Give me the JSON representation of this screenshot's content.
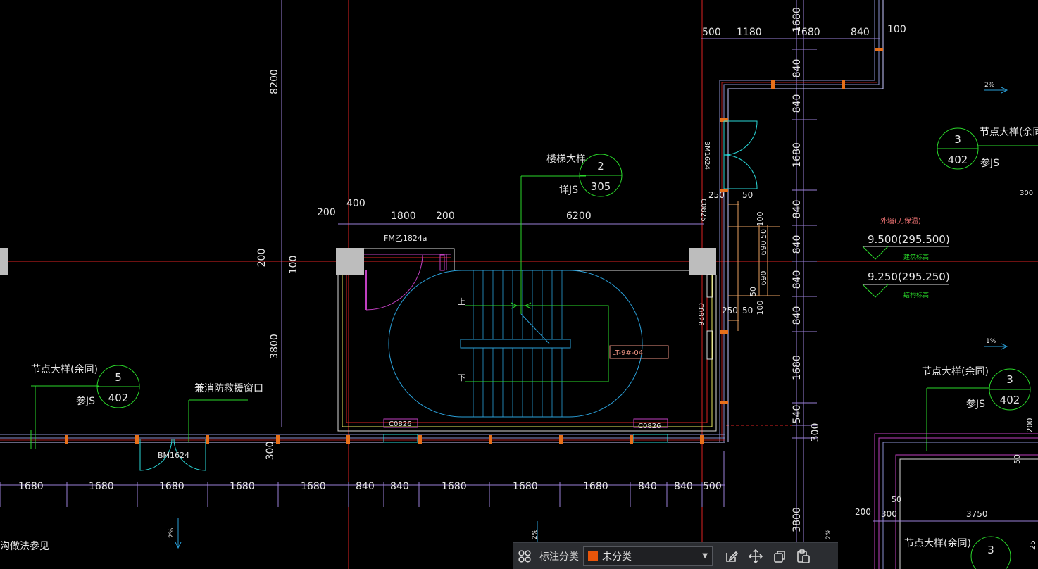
{
  "texts": {
    "top_dims": [
      "500",
      "1180",
      "1680",
      "840",
      "100"
    ],
    "right_col": [
      "1680",
      "840",
      "840",
      "1680",
      "840",
      "840",
      "840",
      "840",
      "1680",
      "540",
      "300",
      "3800"
    ],
    "bottom_dims": [
      "1680",
      "1680",
      "1680",
      "1680",
      "1680",
      "840",
      "840",
      "1680",
      "1680",
      "1680",
      "840",
      "840",
      "500"
    ],
    "left_vert": [
      "8200",
      "200",
      "100",
      "3800",
      "300"
    ],
    "stair_dims": [
      "200",
      "400",
      "1800",
      "200",
      "6200"
    ],
    "door_label": "FM乙1824a",
    "stair_title": "楼梯大样",
    "detail_note": "详JS",
    "bubble_stair": {
      "num": "2",
      "ref": "305"
    },
    "bubble_left": {
      "title": "节点大样(余同)",
      "num": "5",
      "ref": "402",
      "note": "参JS"
    },
    "bubble_right_top": {
      "title": "节点大样(余同)",
      "num": "3",
      "ref": "402",
      "note": "参JS"
    },
    "bubble_right_mid": {
      "title": "节点大样(余同)",
      "num": "3",
      "ref": "402",
      "note": "参JS"
    },
    "bubble_right_bottom": {
      "title": "节点大样(余同)",
      "num": "3"
    },
    "escape_window": "兼消防救援窗口",
    "bm_door": "BM1624",
    "window_c0826": "C0826",
    "window_c0826_2": "C0826",
    "vert_bm": "BM1624",
    "vert_c0826": "C0826",
    "vert_c0826_2": "C0826",
    "up_mark": "上",
    "down_mark": "下",
    "lt_label": "LT-9#-04",
    "elev_note": "外墙(无保温)",
    "elev_1": "9.500(295.500)",
    "elev_1_label": "建筑标高",
    "elev_2": "9.250(295.250)",
    "elev_2_label": "结构标高",
    "slope_1": "2%",
    "slope_2": "1%",
    "slope_3": "2%",
    "slope_4": "2%",
    "slope_5": "2%",
    "d250a": "250",
    "d50a": "50",
    "d250b": "250",
    "d50b": "50",
    "dr": [
      "100",
      "50",
      "690",
      "690",
      "50",
      "100"
    ],
    "d300r": "300",
    "d200b": "200",
    "d300b": "300",
    "d3750": "3750",
    "d50c": "50",
    "d50d": "50",
    "d200r": "200",
    "d25": "25",
    "bottom_left_note": "沟做法参见"
  },
  "toolbar": {
    "label": "标注分类",
    "value": "未分类",
    "swatch": "#e8550a",
    "icons": [
      "layout-grid-icon",
      "edit-icon",
      "move-icon",
      "copy-icon",
      "paste-icon"
    ]
  }
}
